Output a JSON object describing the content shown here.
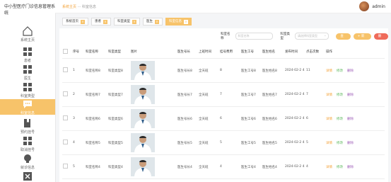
{
  "app": {
    "title": "中小型医疗门诊信息管理系统"
  },
  "sidebar": {
    "items": [
      {
        "label": "系统主页",
        "icon": "home-icon"
      },
      {
        "label": "患者",
        "icon": "grid-icon"
      },
      {
        "label": "医生",
        "icon": "grid-icon"
      },
      {
        "label": "科室类型",
        "icon": "grid-icon"
      },
      {
        "label": "科室信息",
        "icon": "chat-icon",
        "active": true
      },
      {
        "label": "预约挂号",
        "icon": "book-icon"
      },
      {
        "label": "取消挂号",
        "icon": "grid-icon"
      },
      {
        "label": "就诊信息",
        "icon": "brain-icon"
      },
      {
        "label": "",
        "icon": "close-box-icon"
      }
    ]
  },
  "header": {
    "breadcrumb_home": "系统主页",
    "breadcrumb_sep": "···",
    "breadcrumb_current": "科室信息",
    "username": "admin"
  },
  "tabs": [
    {
      "label": "系统首页"
    },
    {
      "label": "患者"
    },
    {
      "label": "科室类型"
    },
    {
      "label": "医生"
    },
    {
      "label": "科室信息",
      "active": true
    }
  ],
  "search": {
    "name_label": "科室名称",
    "name_placeholder": "科室名称",
    "type_label": "科室类型",
    "type_placeholder": "请选择科室类型",
    "search_button": "查询",
    "add_button": "+ 新增",
    "delete_button": "删除"
  },
  "table": {
    "headers": [
      "序号",
      "科室名称",
      "科室类型",
      "图片",
      "医生号长",
      "上班时间",
      "挂号费用",
      "医生工号",
      "医生姓名",
      "发布时间",
      "点击次数",
      "操作"
    ],
    "actions": {
      "detail": "详情",
      "edit": "修改",
      "delete": "删除"
    },
    "rows": [
      {
        "index": "1",
        "name": "科室名称8",
        "type": "科室类型8",
        "doc": "医生号长8",
        "time": "全天班",
        "fee": "8",
        "job": "医生工号8",
        "dname": "医生姓名8",
        "date": "2024-02-2 4",
        "clicks": "11"
      },
      {
        "index": "2",
        "name": "科室名称7",
        "type": "科室类型7",
        "doc": "医生号长7",
        "time": "全天班",
        "fee": "7",
        "job": "医生工号7",
        "dname": "医生姓名7",
        "date": "2024-02-2 4",
        "clicks": "7"
      },
      {
        "index": "3",
        "name": "科室名称6",
        "type": "科室类型6",
        "doc": "医生号长6",
        "time": "全天班",
        "fee": "6",
        "job": "医生工号6",
        "dname": "医生姓名6",
        "date": "2024-02-2 4",
        "clicks": "6"
      },
      {
        "index": "4",
        "name": "科室名称5",
        "type": "科室类型5",
        "doc": "医生号长5",
        "time": "全天班",
        "fee": "5",
        "job": "医生工号5",
        "dname": "医生姓名5",
        "date": "2024-02-2 4",
        "clicks": "5"
      },
      {
        "index": "5",
        "name": "科室名称4",
        "type": "科室类型4",
        "doc": "医生号长4",
        "time": "全天班",
        "fee": "4",
        "job": "医生工号4",
        "dname": "医生姓名4",
        "date": "2024-02-2 4",
        "clicks": "4"
      }
    ]
  },
  "colors": {
    "accent": "#f7c36a",
    "danger": "#ef6b5a",
    "detail": "#f3a33a",
    "edit": "#5bb75b",
    "delete": "#9b59b6"
  }
}
